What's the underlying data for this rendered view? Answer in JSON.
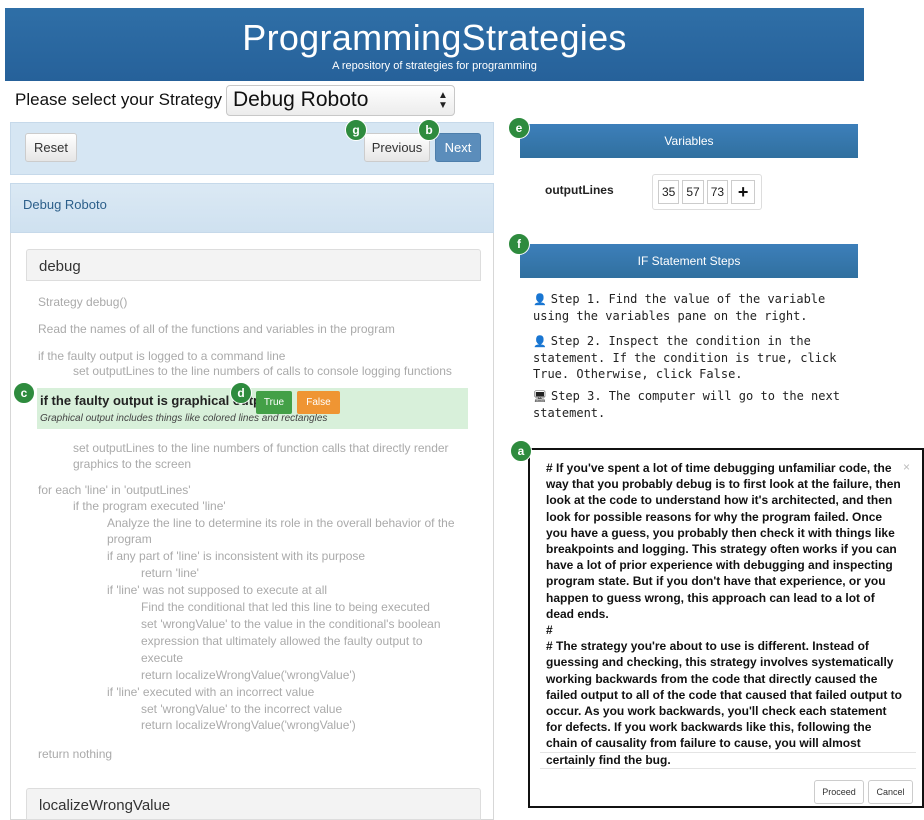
{
  "header": {
    "title": "ProgrammingStrategies",
    "subtitle": "A repository of strategies for programming"
  },
  "selector": {
    "label": "Please select your Strategy",
    "value": "Debug Roboto"
  },
  "controls": {
    "reset": "Reset",
    "previous": "Previous",
    "next": "Next"
  },
  "strategy_name": "Debug Roboto",
  "functions": {
    "first": "debug",
    "second": "localizeWrongValue"
  },
  "code": {
    "l1": "Strategy debug()",
    "l2": "Read the names of all of the functions and variables in the program",
    "l3": "if the faulty output is logged to a command line",
    "l4": "set outputLines to the line numbers of calls to console logging functions",
    "highlight": "if the faulty output is graphical output",
    "highlight_sub": "Graphical output includes things like colored lines and rectangles",
    "l5": "set outputLines to the line numbers of function calls that directly render",
    "l6": "graphics to the screen",
    "l7": "for each 'line' in 'outputLines'",
    "l8": "if the program executed 'line'",
    "l9": "Analyze the line to determine its role in the overall behavior of the",
    "l10": "program",
    "l11": "if any part of 'line' is inconsistent with its purpose",
    "l12": "return 'line'",
    "l13": "if 'line' was not supposed to execute at all",
    "l14": "Find the conditional that led this line to being executed",
    "l15": "set 'wrongValue' to the value in the conditional's boolean",
    "l16": "expression that ultimately allowed the faulty output to",
    "l17": "execute",
    "l18": "return localizeWrongValue('wrongValue')",
    "l19": "if 'line' executed with an incorrect value",
    "l20": "set 'wrongValue' to the incorrect value",
    "l21": "return localizeWrongValue('wrongValue')",
    "l22": "return nothing"
  },
  "decision": {
    "true_label": "True",
    "false_label": "False"
  },
  "variables": {
    "title": "Variables",
    "name": "outputLines",
    "values": [
      "35",
      "57",
      "73"
    ],
    "add": "+"
  },
  "if_steps": {
    "title": "IF Statement Steps",
    "step1": "Step 1. Find the value of the variable using the variables pane on the right.",
    "step2": "Step 2. Inspect the condition in the statement. If the condition is true, click True. Otherwise, click False.",
    "step3": "Step 3. The computer will go to the next statement."
  },
  "modal": {
    "text1": "# If you've spent a lot of time debugging unfamiliar code, the way that you probably debug is to first look at the failure, then look at the code to understand how it's architected, and then look for possible reasons for why the program failed. Once you have a guess, you probably then check it with things like breakpoints and logging. This strategy often works if you can have a lot of prior experience with debugging and inspecting program state. But if you don't have that experience, or you happen to guess wrong, this approach can lead to a lot of dead ends.",
    "text2": "#",
    "text3": "# The strategy you're about to use is different. Instead of guessing and checking, this strategy involves systematically working backwards from the code that directly caused the failed output to all of the code that caused that failed output to occur. As you work backwards, you'll check each statement for defects. If you work backwards like this, following the chain of causality from failure to cause, you will almost certainly find the bug.",
    "close": "×",
    "proceed": "Proceed",
    "cancel": "Cancel"
  },
  "markers": {
    "a": "a",
    "b": "b",
    "c": "c",
    "d": "d",
    "e": "e",
    "f": "f",
    "g": "g"
  },
  "colors": {
    "header": "#2f6fa7",
    "marker": "#2e8b3e",
    "true_button": "#43a047",
    "false_button": "#ef9533",
    "highlight": "#d8f0da"
  }
}
